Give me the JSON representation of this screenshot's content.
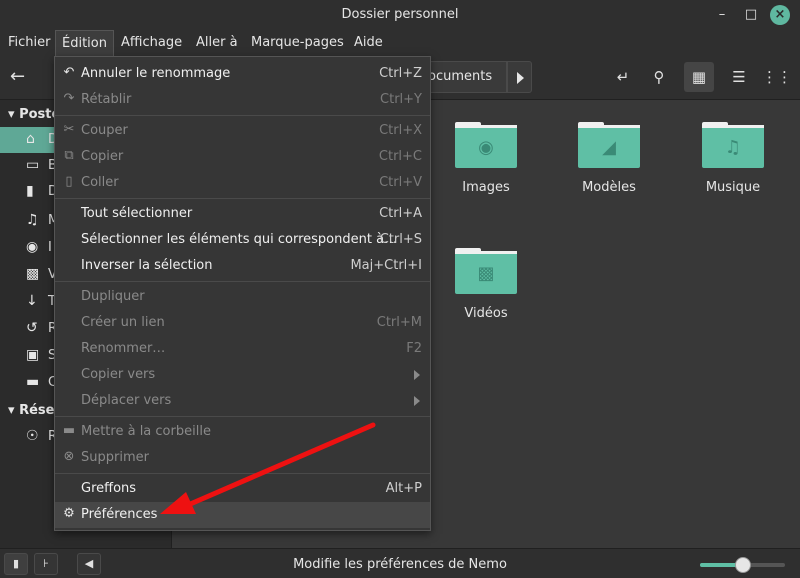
{
  "window": {
    "title": "Dossier personnel"
  },
  "menubar": [
    "Fichier",
    "Édition",
    "Affichage",
    "Aller à",
    "Marque-pages",
    "Aide"
  ],
  "toolbar": {
    "path_label": "ocuments"
  },
  "sidebar": {
    "section1": "Poste",
    "items": [
      "D",
      "B",
      "D",
      "M",
      "I",
      "V",
      "T",
      "R",
      "S",
      "C"
    ],
    "section2": "Rése",
    "items2": [
      "R"
    ]
  },
  "main": {
    "folders": [
      {
        "label": "Images",
        "icon": "camera-icon"
      },
      {
        "label": "Modèles",
        "icon": "template-icon"
      },
      {
        "label": "Musique",
        "icon": "music-icon"
      },
      {
        "label": "Vidéos",
        "icon": "film-icon"
      }
    ]
  },
  "menu": {
    "undo": {
      "label": "Annuler le renommage",
      "shortcut": "Ctrl+Z"
    },
    "redo": {
      "label": "Rétablir",
      "shortcut": "Ctrl+Y"
    },
    "cut": {
      "label": "Couper",
      "shortcut": "Ctrl+X"
    },
    "copy": {
      "label": "Copier",
      "shortcut": "Ctrl+C"
    },
    "paste": {
      "label": "Coller",
      "shortcut": "Ctrl+V"
    },
    "select_all": {
      "label": "Tout sélectionner",
      "shortcut": "Ctrl+A"
    },
    "select_matching": {
      "label": "Sélectionner les éléments qui correspondent à…",
      "shortcut": "Ctrl+S"
    },
    "invert": {
      "label": "Inverser la sélection",
      "shortcut": "Maj+Ctrl+I"
    },
    "duplicate": {
      "label": "Dupliquer"
    },
    "link": {
      "label": "Créer un lien",
      "shortcut": "Ctrl+M"
    },
    "rename": {
      "label": "Renommer…",
      "shortcut": "F2"
    },
    "copy_to": {
      "label": "Copier vers"
    },
    "move_to": {
      "label": "Déplacer vers"
    },
    "trash": {
      "label": "Mettre à la corbeille"
    },
    "delete": {
      "label": "Supprimer"
    },
    "plugins": {
      "label": "Greffons",
      "shortcut": "Alt+P"
    },
    "preferences": {
      "label": "Préférences"
    }
  },
  "status": {
    "text": "Modifie les préférences de Nemo",
    "zoom": 0.5
  },
  "colors": {
    "accent": "#5fbfa5",
    "selection": "#5fa896",
    "arrow": "#ee1111"
  }
}
